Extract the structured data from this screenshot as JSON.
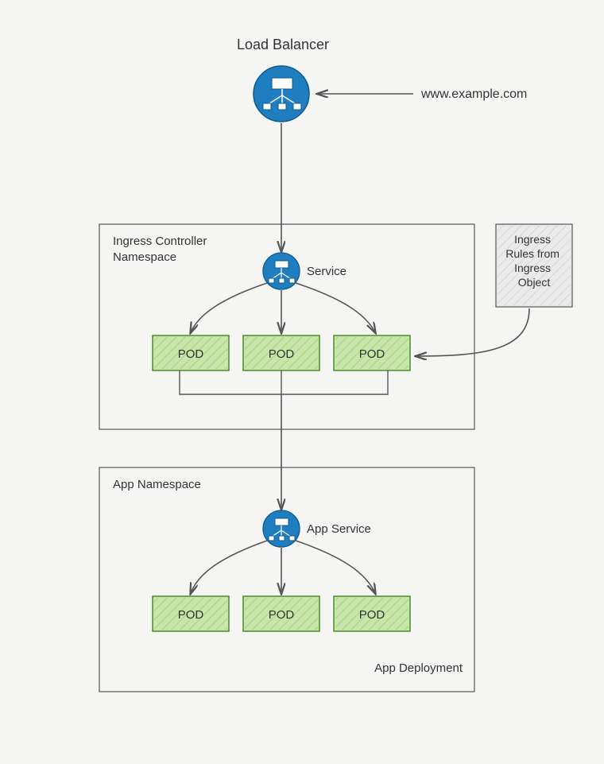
{
  "title": "Load Balancer",
  "external_host": "www.example.com",
  "ingress_ns": {
    "label": "Ingress Controller\nNamespace",
    "service_label": "Service",
    "pods": [
      "POD",
      "POD",
      "POD"
    ]
  },
  "ingress_rules_box": "Ingress\nRules from\nIngress\nObject",
  "app_ns": {
    "label": "App Namespace",
    "service_label": "App Service",
    "pods": [
      "POD",
      "POD",
      "POD"
    ],
    "deployment_label": "App Deployment"
  },
  "colors": {
    "lb_fill": "#1f7ec0",
    "pod_fill": "#c7e6a9",
    "pod_stroke": "#4b8b2b",
    "ink": "#333333"
  }
}
